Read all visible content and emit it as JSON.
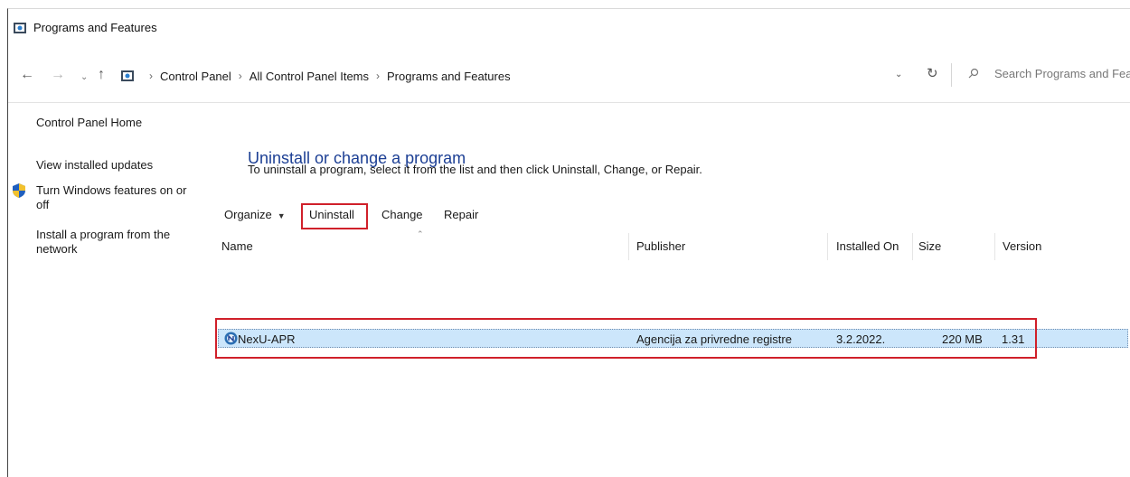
{
  "window": {
    "title": "Programs and Features"
  },
  "address_bar": {
    "breadcrumbs": [
      "Control Panel",
      "All Control Panel Items",
      "Programs and Features"
    ],
    "search_placeholder": "Search Programs and Fea"
  },
  "sidebar": {
    "links": [
      {
        "label": "Control Panel Home"
      },
      {
        "label": "View installed updates"
      },
      {
        "label_line1": "Turn Windows features on or",
        "label_line2": "off",
        "icon": "shield-icon"
      },
      {
        "label_line1": "Install a program from the",
        "label_line2": "network"
      }
    ]
  },
  "main": {
    "title": "Uninstall or change a program",
    "description": "To uninstall a program, select it from the list and then click Uninstall, Change, or Repair."
  },
  "toolbar": {
    "organize": "Organize",
    "uninstall": "Uninstall",
    "change": "Change",
    "repair": "Repair"
  },
  "table": {
    "columns": [
      "Name",
      "Publisher",
      "Installed On",
      "Size",
      "Version"
    ],
    "rows": [
      {
        "name": "NexU-APR",
        "publisher": "Agencija za privredne registre",
        "installed_on": "3.2.2022.",
        "size": "220 MB",
        "version": "1.31",
        "selected": true
      }
    ]
  },
  "colors": {
    "accent_title": "#1c3f94",
    "selection": "#cce6fb",
    "highlight_annotation": "#d0202a"
  }
}
